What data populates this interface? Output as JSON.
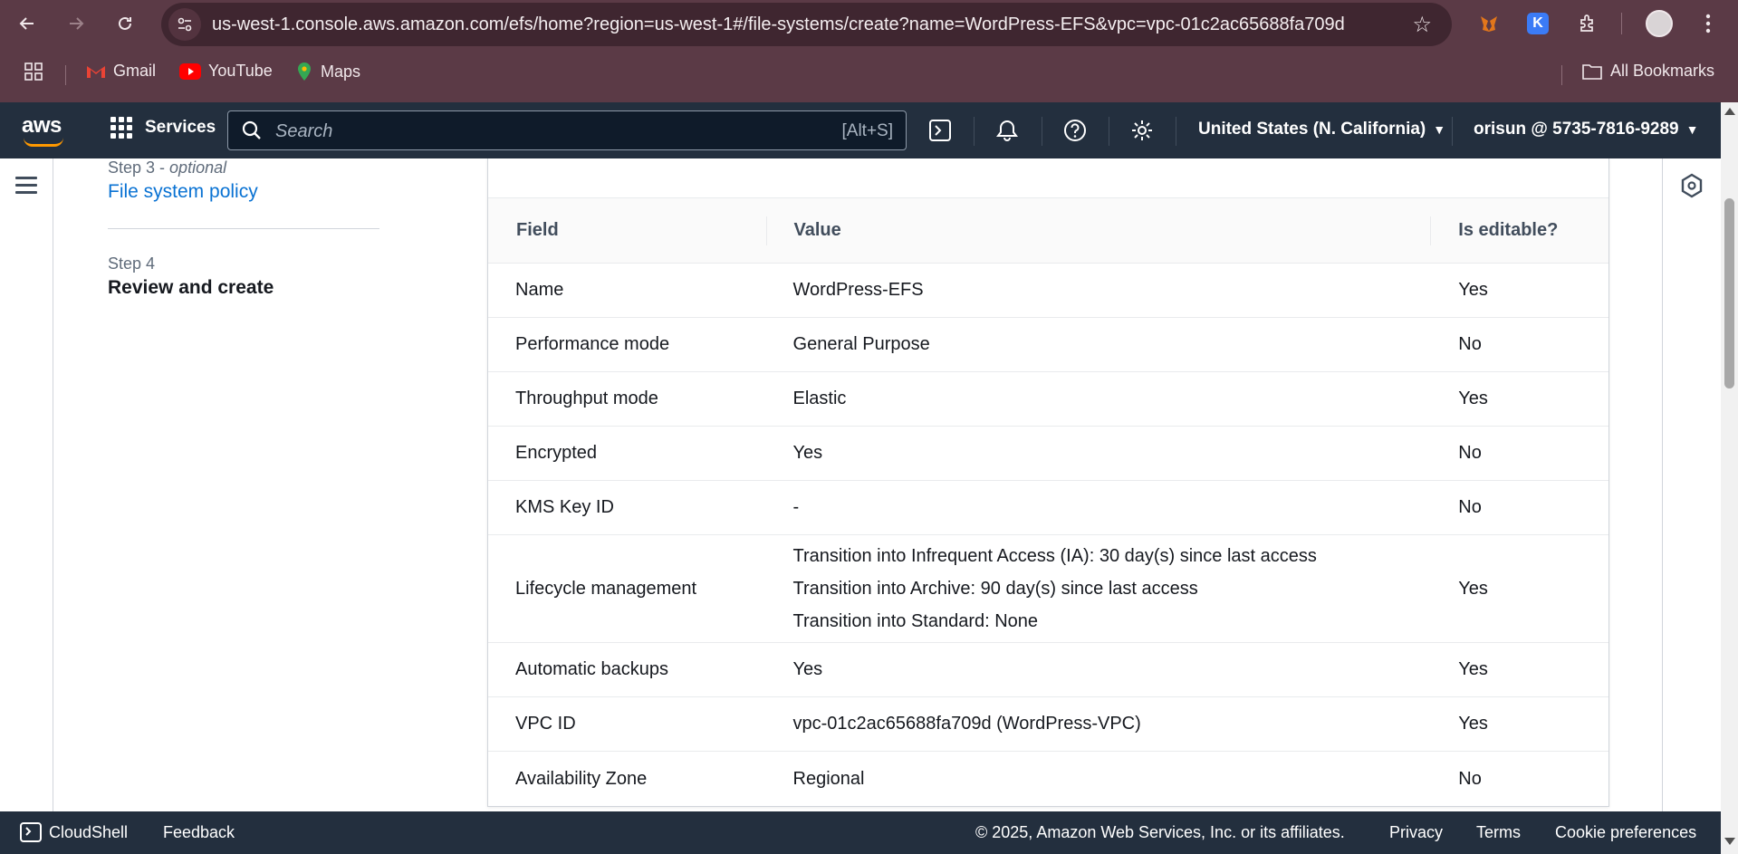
{
  "browser": {
    "url": "us-west-1.console.aws.amazon.com/efs/home?region=us-west-1#/file-systems/create?name=WordPress-EFS&vpc=vpc-01c2ac65688fa709d",
    "bookmarks": [
      "Gmail",
      "YouTube",
      "Maps"
    ],
    "all_bookmarks": "All Bookmarks",
    "extension_letter": "K"
  },
  "aws_header": {
    "logo": "aws",
    "services": "Services",
    "search_placeholder": "Search",
    "search_shortcut": "[Alt+S]",
    "region": "United States (N. California)",
    "account": "orisun @ 5735-7816-9289"
  },
  "steps": {
    "step3_label": "Step 3 - ",
    "step3_optional": "optional",
    "step3_title": "File system policy",
    "step4_label": "Step 4",
    "step4_title": "Review and create"
  },
  "table": {
    "headers": [
      "Field",
      "Value",
      "Is editable?"
    ],
    "rows": [
      {
        "field": "Name",
        "value": "WordPress-EFS",
        "editable": "Yes"
      },
      {
        "field": "Performance mode",
        "value": "General Purpose",
        "editable": "No"
      },
      {
        "field": "Throughput mode",
        "value": "Elastic",
        "editable": "Yes"
      },
      {
        "field": "Encrypted",
        "value": "Yes",
        "editable": "No"
      },
      {
        "field": "KMS Key ID",
        "value": "-",
        "editable": "No"
      },
      {
        "field": "Lifecycle management",
        "lines": [
          "Transition into Infrequent Access (IA): 30 day(s) since last access",
          "Transition into Archive: 90 day(s) since last access",
          "Transition into Standard: None"
        ],
        "editable": "Yes"
      },
      {
        "field": "Automatic backups",
        "value": "Yes",
        "editable": "Yes"
      },
      {
        "field": "VPC ID",
        "value": "vpc-01c2ac65688fa709d (WordPress-VPC)",
        "editable": "Yes"
      },
      {
        "field": "Availability Zone",
        "value": "Regional",
        "editable": "No"
      }
    ]
  },
  "footer": {
    "cloudshell": "CloudShell",
    "feedback": "Feedback",
    "copyright": "© 2025, Amazon Web Services, Inc. or its affiliates.",
    "privacy": "Privacy",
    "terms": "Terms",
    "cookies": "Cookie preferences"
  },
  "colors": {
    "browser_frame": "#5b3a46",
    "aws_header": "#232f3e",
    "link": "#0972d3",
    "aws_orange": "#ff9900"
  }
}
